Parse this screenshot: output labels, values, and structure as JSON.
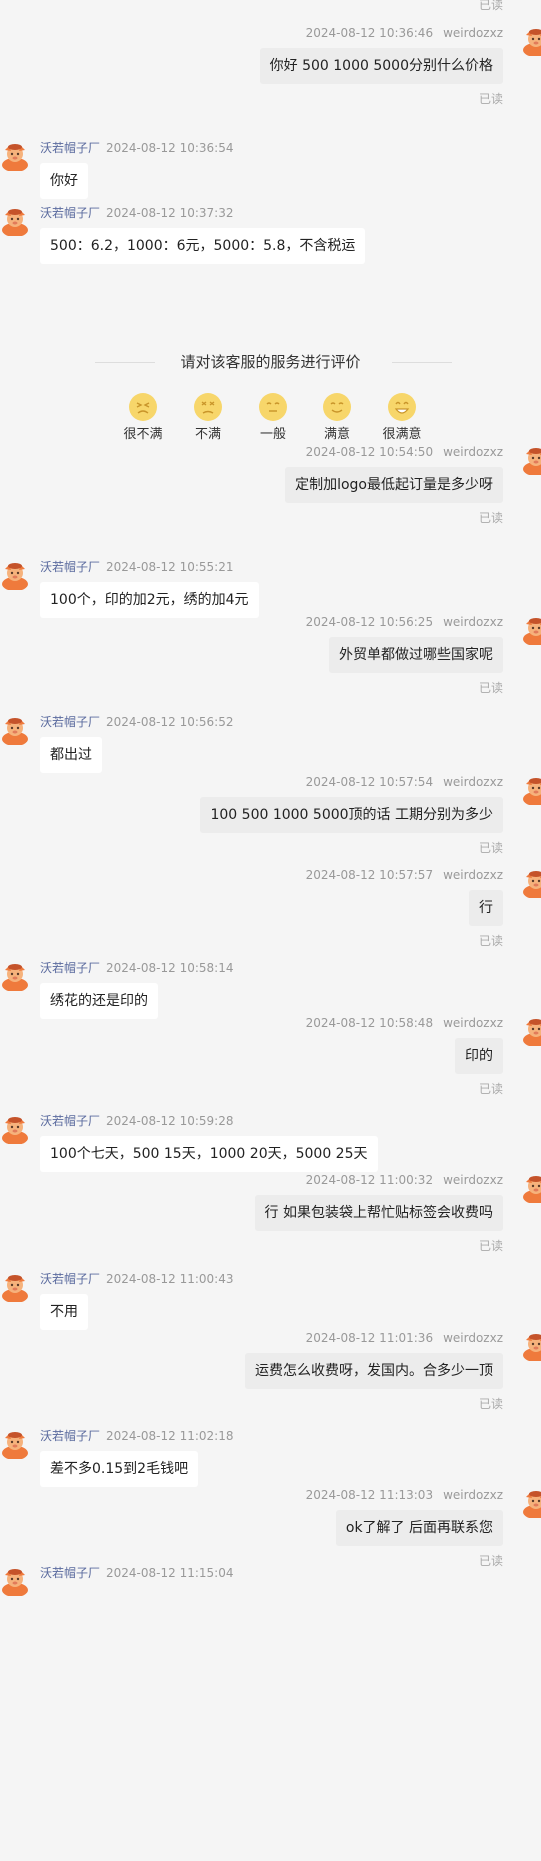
{
  "top_read": "已读",
  "me_name": "weirdozxz",
  "shop_name": "沃若帽子厂",
  "read_label": "已读",
  "messages": [
    {
      "side": "right",
      "time": "2024-08-12 10:36:46",
      "text": "你好 500 1000 5000分别什么价格"
    },
    {
      "side": "left",
      "time": "2024-08-12 10:36:54",
      "text": "你好"
    },
    {
      "side": "left",
      "time": "2024-08-12 10:37:32",
      "text": "500：6.2，1000：6元，5000：5.8，不含税运"
    },
    {
      "side": "right",
      "time": "2024-08-12 10:54:50",
      "text": "定制加logo最低起订量是多少呀"
    },
    {
      "side": "left",
      "time": "2024-08-12 10:55:21",
      "text": "100个，印的加2元，绣的加4元"
    },
    {
      "side": "right",
      "time": "2024-08-12 10:56:25",
      "text": "外贸单都做过哪些国家呢"
    },
    {
      "side": "left",
      "time": "2024-08-12 10:56:52",
      "text": "都出过"
    },
    {
      "side": "right",
      "time": "2024-08-12 10:57:54",
      "text": "100 500 1000 5000顶的话 工期分别为多少"
    },
    {
      "side": "right",
      "time": "2024-08-12 10:57:57",
      "text": "行"
    },
    {
      "side": "left",
      "time": "2024-08-12 10:58:14",
      "text": "绣花的还是印的"
    },
    {
      "side": "right",
      "time": "2024-08-12 10:58:48",
      "text": "印的"
    },
    {
      "side": "left",
      "time": "2024-08-12 10:59:28",
      "text": "100个七天，500 15天，1000 20天，5000 25天"
    },
    {
      "side": "right",
      "time": "2024-08-12 11:00:32",
      "text": "行 如果包装袋上帮忙贴标签会收费吗"
    },
    {
      "side": "left",
      "time": "2024-08-12 11:00:43",
      "text": "不用"
    },
    {
      "side": "right",
      "time": "2024-08-12 11:01:36",
      "text": "运费怎么收费呀，发国内。合多少一顶"
    },
    {
      "side": "left",
      "time": "2024-08-12 11:02:18",
      "text": "差不多0.15到2毛钱吧"
    },
    {
      "side": "right",
      "time": "2024-08-12 11:13:03",
      "text": "ok了解了 后面再联系您"
    },
    {
      "side": "left",
      "time": "2024-08-12 11:15:04",
      "text": ""
    }
  ],
  "rating": {
    "title": "请对该客服的服务进行评价",
    "options": [
      {
        "label": "很不满",
        "icon": "very-dissatisfied-face-icon"
      },
      {
        "label": "不满",
        "icon": "dissatisfied-face-icon"
      },
      {
        "label": "一般",
        "icon": "neutral-face-icon"
      },
      {
        "label": "满意",
        "icon": "satisfied-face-icon"
      },
      {
        "label": "很满意",
        "icon": "very-satisfied-face-icon"
      }
    ]
  },
  "colors": {
    "background": "#f5f5f5",
    "left_bubble": "#ffffff",
    "right_bubble": "#ececec",
    "shop_name": "#5a6a9e",
    "face": "#f7d66a",
    "avatar": "#ef7a3c"
  }
}
